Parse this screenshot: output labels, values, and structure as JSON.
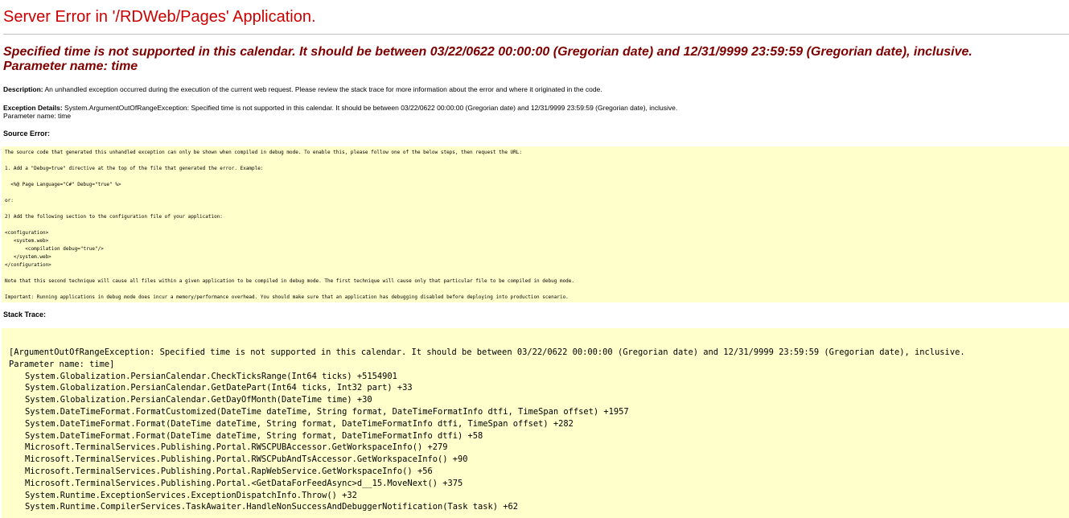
{
  "page": {
    "title": "Server Error in '/RDWeb/Pages' Application.",
    "error_message_line1": "Specified time is not supported in this calendar. It should be between 03/22/0622 00:00:00 (Gregorian date) and 12/31/9999 23:59:59 (Gregorian date), inclusive.",
    "error_message_line2": "Parameter name: time"
  },
  "description": {
    "label": "Description:",
    "text": " An unhandled exception occurred during the execution of the current web request. Please review the stack trace for more information about the error and where it originated in the code."
  },
  "exception_details": {
    "label": "Exception Details:",
    "text": " System.ArgumentOutOfRangeException: Specified time is not supported in this calendar. It should be between 03/22/0622 00:00:00 (Gregorian date) and 12/31/9999 23:59:59 (Gregorian date), inclusive.",
    "param": "Parameter name: time"
  },
  "source_error": {
    "label": "Source Error:",
    "lines": [
      "The source code that generated this unhandled exception can only be shown when compiled in debug mode. To enable this, please follow one of the below steps, then request the URL:",
      "",
      "1. Add a \"Debug=true\" directive at the top of the file that generated the error. Example:",
      "",
      "  <%@ Page Language=\"C#\" Debug=\"true\" %>",
      "",
      "or:",
      "",
      "2) Add the following section to the configuration file of your application:",
      "",
      "<configuration>",
      "   <system.web>",
      "       <compilation debug=\"true\"/>",
      "   </system.web>",
      "</configuration>",
      "",
      "Note that this second technique will cause all files within a given application to be compiled in debug mode. The first technique will cause only that particular file to be compiled in debug mode.",
      "",
      "Important: Running applications in debug mode does incur a memory/performance overhead. You should make sure that an application has debugging disabled before deploying into production scenario."
    ]
  },
  "stack_trace": {
    "label": "Stack Trace:",
    "header_line1": "[ArgumentOutOfRangeException: Specified time is not supported in this calendar. It should be between 03/22/0622 00:00:00 (Gregorian date) and 12/31/9999 23:59:59 (Gregorian date), inclusive.",
    "header_line2": "Parameter name: time]",
    "frames": [
      "System.Globalization.PersianCalendar.CheckTicksRange(Int64 ticks) +5154901",
      "System.Globalization.PersianCalendar.GetDatePart(Int64 ticks, Int32 part) +33",
      "System.Globalization.PersianCalendar.GetDayOfMonth(DateTime time) +30",
      "System.DateTimeFormat.FormatCustomized(DateTime dateTime, String format, DateTimeFormatInfo dtfi, TimeSpan offset) +1957",
      "System.DateTimeFormat.Format(DateTime dateTime, String format, DateTimeFormatInfo dtfi, TimeSpan offset) +282",
      "System.DateTimeFormat.Format(DateTime dateTime, String format, DateTimeFormatInfo dtfi) +58",
      "Microsoft.TerminalServices.Publishing.Portal.RWSCPUBAccessor.GetWorkspaceInfo() +279",
      "Microsoft.TerminalServices.Publishing.Portal.RWSCPubAndTsAccessor.GetWorkspaceInfo() +90",
      "Microsoft.TerminalServices.Publishing.Portal.RapWebService.GetWorkspaceInfo() +56",
      "Microsoft.TerminalServices.Publishing.Portal.<GetDataForFeedAsync>d__15.MoveNext() +375",
      "System.Runtime.ExceptionServices.ExceptionDispatchInfo.Throw() +32",
      "System.Runtime.CompilerServices.TaskAwaiter.HandleNonSuccessAndDebuggerNotification(Task task) +62"
    ]
  },
  "colors": {
    "title": "#cc0000",
    "message": "#800000",
    "code_background": "#ffffcc",
    "rule": "#c0c0c0"
  }
}
